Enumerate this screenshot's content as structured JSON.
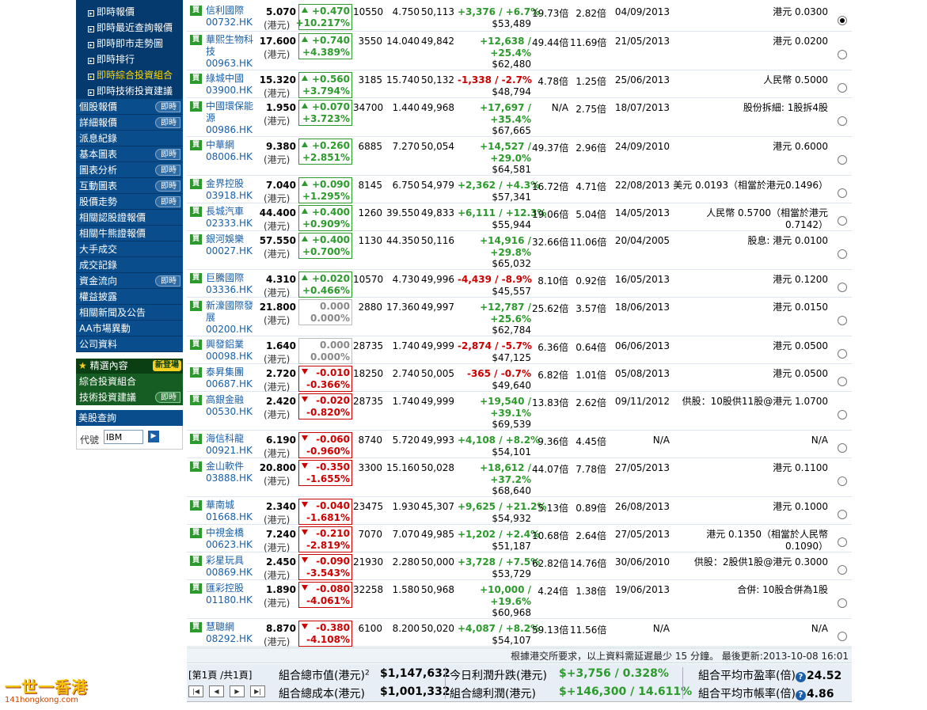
{
  "sidebar": {
    "sub_items": [
      "即時報價",
      "即時最近查詢報價",
      "即時即市走勢圖",
      "即時排行",
      "即時綜合投資組合",
      "即時技術投資建議"
    ],
    "nav_items": [
      {
        "label": "個股報價",
        "badge": "即時"
      },
      {
        "label": "詳細報價",
        "badge": "即時"
      },
      {
        "label": "派息紀錄",
        "badge": ""
      },
      {
        "label": "基本圖表",
        "badge": "即時"
      },
      {
        "label": "圖表分析",
        "badge": "即時"
      },
      {
        "label": "互動圖表",
        "badge": "即時"
      },
      {
        "label": "股價走勢",
        "badge": "即時"
      },
      {
        "label": "相關認股證報價",
        "badge": ""
      },
      {
        "label": "相關牛熊證報價",
        "badge": ""
      },
      {
        "label": "大手成交",
        "badge": ""
      },
      {
        "label": "成交記錄",
        "badge": ""
      },
      {
        "label": "資金流向",
        "badge": "即時"
      },
      {
        "label": "權益披露",
        "badge": ""
      },
      {
        "label": "相關新聞及公告",
        "badge": ""
      },
      {
        "label": "AA市場異動",
        "badge": ""
      },
      {
        "label": "公司資料",
        "badge": ""
      }
    ],
    "featured_label": "精選內容",
    "featured_badge": "新登場",
    "green_items": [
      {
        "label": "綜合投資組合",
        "badge": ""
      },
      {
        "label": "技術投資建議",
        "badge": "即時"
      }
    ],
    "us_title": "美股查詢",
    "us_code_label": "代號",
    "us_code_value": "IBM"
  },
  "buy_label": "買",
  "currency": "(港元)",
  "rows": [
    {
      "name": "信利國際",
      "code": "00732.HK",
      "price": "5.070",
      "chg": "+0.470",
      "pct": "+10.217%",
      "dir": "up",
      "shares": "10550",
      "cost": "4.750",
      "invest": "50,113",
      "pnl": "+3,376 / +6.7%",
      "mv": "$53,489",
      "pe": "19.73倍",
      "pb": "2.82倍",
      "date": "04/09/2013",
      "div": "港元 0.0300",
      "sel": true
    },
    {
      "name": "華熙生物科技",
      "code": "00963.HK",
      "price": "17.600",
      "chg": "+0.740",
      "pct": "+4.389%",
      "dir": "up",
      "shares": "3550",
      "cost": "14.040",
      "invest": "49,842",
      "pnl": "+12,638 / +25.4%",
      "mv": "$62,480",
      "pe": "49.44倍",
      "pb": "11.69倍",
      "date": "21/05/2013",
      "div": "港元 0.0200",
      "sel": false
    },
    {
      "name": "綠城中國",
      "code": "03900.HK",
      "price": "15.320",
      "chg": "+0.560",
      "pct": "+3.794%",
      "dir": "up",
      "shares": "3185",
      "cost": "15.740",
      "invest": "50,132",
      "pnl": "-1,338 / -2.7%",
      "mv": "$48,794",
      "pe": "4.78倍",
      "pb": "1.25倍",
      "date": "25/06/2013",
      "div": "人民幣 0.5000",
      "sel": false
    },
    {
      "name": "中國環保能源",
      "code": "00986.HK",
      "price": "1.950",
      "chg": "+0.070",
      "pct": "+3.723%",
      "dir": "up",
      "shares": "34700",
      "cost": "1.440",
      "invest": "49,968",
      "pnl": "+17,697 / +35.4%",
      "mv": "$67,665",
      "pe": "N/A",
      "pb": "2.75倍",
      "date": "18/07/2013",
      "div": "股份拆細: 1股拆4股",
      "sel": false
    },
    {
      "name": "中華網",
      "code": "08006.HK",
      "price": "9.380",
      "chg": "+0.260",
      "pct": "+2.851%",
      "dir": "up",
      "shares": "6885",
      "cost": "7.270",
      "invest": "50,054",
      "pnl": "+14,527 / +29.0%",
      "mv": "$64,581",
      "pe": "49.37倍",
      "pb": "2.96倍",
      "date": "24/09/2010",
      "div": "港元 0.6000",
      "sel": false
    },
    {
      "name": "金界控股",
      "code": "03918.HK",
      "price": "7.040",
      "chg": "+0.090",
      "pct": "+1.295%",
      "dir": "up",
      "shares": "8145",
      "cost": "6.750",
      "invest": "54,979",
      "pnl": "+2,362 / +4.3%",
      "mv": "$57,341",
      "pe": "16.72倍",
      "pb": "4.71倍",
      "date": "22/08/2013",
      "div": "美元 0.0193（相當於港元0.1496）",
      "sel": false
    },
    {
      "name": "長城汽車",
      "code": "02333.HK",
      "price": "44.400",
      "chg": "+0.400",
      "pct": "+0.909%",
      "dir": "up",
      "shares": "1260",
      "cost": "39.550",
      "invest": "49,833",
      "pnl": "+6,111 / +12.3%",
      "mv": "$55,944",
      "pe": "19.06倍",
      "pb": "5.04倍",
      "date": "14/05/2013",
      "div": "人民幣 0.5700（相當於港元 0.7142）",
      "sel": false
    },
    {
      "name": "銀河娛樂",
      "code": "00027.HK",
      "price": "57.550",
      "chg": "+0.400",
      "pct": "+0.700%",
      "dir": "up",
      "shares": "1130",
      "cost": "44.350",
      "invest": "50,116",
      "pnl": "+14,916 / +29.8%",
      "mv": "$65,032",
      "pe": "32.66倍",
      "pb": "11.06倍",
      "date": "20/04/2005",
      "div": "股息: 港元 0.0100",
      "sel": false
    },
    {
      "name": "巨騰國際",
      "code": "03336.HK",
      "price": "4.310",
      "chg": "+0.020",
      "pct": "+0.466%",
      "dir": "up",
      "shares": "10570",
      "cost": "4.730",
      "invest": "49,996",
      "pnl": "-4,439 / -8.9%",
      "mv": "$45,557",
      "pe": "8.10倍",
      "pb": "0.92倍",
      "date": "16/05/2013",
      "div": "港元 0.1200",
      "sel": false
    },
    {
      "name": "新濠國際發展",
      "code": "00200.HK",
      "price": "21.800",
      "chg": "0.000",
      "pct": "0.000%",
      "dir": "flat",
      "shares": "2880",
      "cost": "17.360",
      "invest": "49,997",
      "pnl": "+12,787 / +25.6%",
      "mv": "$62,784",
      "pe": "25.62倍",
      "pb": "3.57倍",
      "date": "18/06/2013",
      "div": "港元 0.0150",
      "sel": false
    },
    {
      "name": "興發鋁業",
      "code": "00098.HK",
      "price": "1.640",
      "chg": "0.000",
      "pct": "0.000%",
      "dir": "flat",
      "shares": "28735",
      "cost": "1.740",
      "invest": "49,999",
      "pnl": "-2,874 / -5.7%",
      "mv": "$47,125",
      "pe": "6.36倍",
      "pb": "0.64倍",
      "date": "06/06/2013",
      "div": "港元 0.0500",
      "sel": false
    },
    {
      "name": "泰昇集團",
      "code": "00687.HK",
      "price": "2.720",
      "chg": "-0.010",
      "pct": "-0.366%",
      "dir": "dn",
      "shares": "18250",
      "cost": "2.740",
      "invest": "50,005",
      "pnl": "-365 / -0.7%",
      "mv": "$49,640",
      "pe": "6.82倍",
      "pb": "1.01倍",
      "date": "05/08/2013",
      "div": "港元 0.0500",
      "sel": false
    },
    {
      "name": "高銀金融",
      "code": "00530.HK",
      "price": "2.420",
      "chg": "-0.020",
      "pct": "-0.820%",
      "dir": "dn",
      "shares": "28735",
      "cost": "1.740",
      "invest": "49,999",
      "pnl": "+19,540 / +39.1%",
      "mv": "$69,539",
      "pe": "13.83倍",
      "pb": "2.62倍",
      "date": "09/11/2012",
      "div": "供股：10股供11股@港元 1.0700",
      "sel": false
    },
    {
      "name": "海信科龍",
      "code": "00921.HK",
      "price": "6.190",
      "chg": "-0.060",
      "pct": "-0.960%",
      "dir": "dn",
      "shares": "8740",
      "cost": "5.720",
      "invest": "49,993",
      "pnl": "+4,108 / +8.2%",
      "mv": "$54,101",
      "pe": "9.36倍",
      "pb": "4.45倍",
      "date": "N/A",
      "div": "N/A",
      "sel": false
    },
    {
      "name": "金山軟件",
      "code": "03888.HK",
      "price": "20.800",
      "chg": "-0.350",
      "pct": "-1.655%",
      "dir": "dn",
      "shares": "3300",
      "cost": "15.160",
      "invest": "50,028",
      "pnl": "+18,612 / +37.2%",
      "mv": "$68,640",
      "pe": "44.07倍",
      "pb": "7.78倍",
      "date": "27/05/2013",
      "div": "港元 0.1100",
      "sel": false
    },
    {
      "name": "華南城",
      "code": "01668.HK",
      "price": "2.340",
      "chg": "-0.040",
      "pct": "-1.681%",
      "dir": "dn",
      "shares": "23475",
      "cost": "1.930",
      "invest": "45,307",
      "pnl": "+9,625 / +21.2%",
      "mv": "$54,932",
      "pe": "5.13倍",
      "pb": "0.89倍",
      "date": "26/08/2013",
      "div": "港元 0.1000",
      "sel": false
    },
    {
      "name": "中視金橋",
      "code": "00623.HK",
      "price": "7.240",
      "chg": "-0.210",
      "pct": "-2.819%",
      "dir": "dn",
      "shares": "7070",
      "cost": "7.070",
      "invest": "49,985",
      "pnl": "+1,202 / +2.4%",
      "mv": "$51,187",
      "pe": "10.68倍",
      "pb": "2.64倍",
      "date": "27/05/2013",
      "div": "港元 0.1350（相當於人民幣 0.1090）",
      "sel": false
    },
    {
      "name": "彩星玩具",
      "code": "00869.HK",
      "price": "2.450",
      "chg": "-0.090",
      "pct": "-3.543%",
      "dir": "dn",
      "shares": "21930",
      "cost": "2.280",
      "invest": "50,000",
      "pnl": "+3,728 / +7.5%",
      "mv": "$53,729",
      "pe": "62.82倍",
      "pb": "14.76倍",
      "date": "30/06/2010",
      "div": "供股：2股供1股@港元 0.3000",
      "sel": false
    },
    {
      "name": "匯彩控股",
      "code": "01180.HK",
      "price": "1.890",
      "chg": "-0.080",
      "pct": "-4.061%",
      "dir": "dn",
      "shares": "32258",
      "cost": "1.580",
      "invest": "50,968",
      "pnl": "+10,000 / +19.6%",
      "mv": "$60,968",
      "pe": "4.24倍",
      "pb": "1.38倍",
      "date": "19/06/2013",
      "div": "合併: 10股合併為1股",
      "sel": false
    },
    {
      "name": "慧聰網",
      "code": "08292.HK",
      "price": "8.870",
      "chg": "-0.380",
      "pct": "-4.108%",
      "dir": "dn",
      "shares": "6100",
      "cost": "8.200",
      "invest": "50,020",
      "pnl": "+4,087 / +8.2%",
      "mv": "$54,107",
      "pe": "59.13倍",
      "pb": "11.56倍",
      "date": "N/A",
      "div": "N/A",
      "sel": false
    }
  ],
  "note": "根據港交所要求，以上資料需延遲最少  15 分鐘。 最後更新:2013-10-08 16:01",
  "summary": {
    "page": "[第1頁 /共1頁]",
    "mv_label": "組合總市值(港元)",
    "mv_sup": "2",
    "mv_value": "$1,147,632",
    "cost_label": "組合總成本(港元)",
    "cost_value": "$1,001,332",
    "today_label": "今日利潤升跌(港元)",
    "today_value": "$+3,756 / 0.328%",
    "total_label": "組合總利潤(港元)",
    "total_value": "$+146,300 / 14.611%",
    "pe_label": "組合平均市盈率(倍)",
    "pe_value": "24.52",
    "pb_label": "組合平均市帳率(倍)",
    "pb_value": "4.86",
    "q_mark": "?"
  },
  "logo": {
    "main": "一世一香港",
    "sub": "141hongkong.com"
  }
}
